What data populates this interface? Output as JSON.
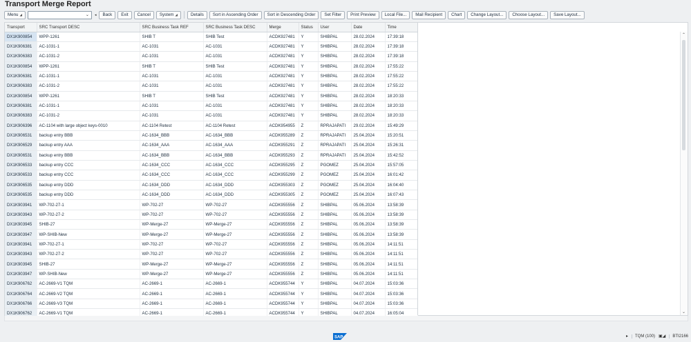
{
  "app": {
    "title": "Transport Merge Report"
  },
  "toolbar": {
    "menu_label": "Menu",
    "back_label": "Back",
    "exit_label": "Exit",
    "cancel_label": "Cancel",
    "system_label": "System",
    "details_label": "Details",
    "sort_asc_label": "Sort in Ascending Order",
    "sort_desc_label": "Sort in Descending Order",
    "set_filter_label": "Set Filter",
    "print_preview_label": "Print Preview",
    "local_file_label": "Local File...",
    "mail_recipient_label": "Mail Recipient",
    "chart_label": "Chart",
    "change_layout_label": "Change Layout...",
    "choose_layout_label": "Choose Layout...",
    "save_layout_label": "Save Layout...",
    "command_field_value": ""
  },
  "table": {
    "columns": [
      "Transport",
      "SRC Transport DESC",
      "SRC Business Task REF",
      "SRC Business Task DESC",
      "Merge",
      "Status",
      "User",
      "Date",
      "Time"
    ],
    "rows": [
      [
        "DX1K900854",
        "WPP-1261",
        "SHIB T",
        "SHIB Test",
        "ACDK927481",
        "Y",
        "SHIBPAL",
        "28.02.2024",
        "17:39:18"
      ],
      [
        "DX1K906381",
        "AC-1031-1",
        "AC-1031",
        "AC-1031",
        "ACDK927481",
        "Y",
        "SHIBPAL",
        "28.02.2024",
        "17:39:18"
      ],
      [
        "DX1K906383",
        "AC-1031-2",
        "AC-1031",
        "AC-1031",
        "ACDK927481",
        "Y",
        "SHIBPAL",
        "28.02.2024",
        "17:39:18"
      ],
      [
        "DX1K900854",
        "WPP-1261",
        "SHIB T",
        "SHIB Test",
        "ACDK927481",
        "Y",
        "SHIBPAL",
        "28.02.2024",
        "17:55:22"
      ],
      [
        "DX1K906381",
        "AC-1031-1",
        "AC-1031",
        "AC-1031",
        "ACDK927481",
        "Y",
        "SHIBPAL",
        "28.02.2024",
        "17:55:22"
      ],
      [
        "DX1K906383",
        "AC-1031-2",
        "AC-1031",
        "AC-1031",
        "ACDK927481",
        "Y",
        "SHIBPAL",
        "28.02.2024",
        "17:55:22"
      ],
      [
        "DX1K900854",
        "WPP-1261",
        "SHIB T",
        "SHIB Test",
        "ACDK927481",
        "Y",
        "SHIBPAL",
        "28.02.2024",
        "18:20:33"
      ],
      [
        "DX1K906381",
        "AC-1031-1",
        "AC-1031",
        "AC-1031",
        "ACDK927481",
        "Y",
        "SHIBPAL",
        "28.02.2024",
        "18:20:33"
      ],
      [
        "DX1K906383",
        "AC-1031-2",
        "AC-1031",
        "AC-1031",
        "ACDK927481",
        "Y",
        "SHIBPAL",
        "28.02.2024",
        "18:20:33"
      ],
      [
        "DX1K906396",
        "AC-1104 with large object keys-0010",
        "AC-1104 Retest",
        "AC-1104 Retest",
        "ACDK954955",
        "Z",
        "RPRAJAPATI",
        "29.02.2024",
        "15:49:29"
      ],
      [
        "DX1K906531",
        "backup entry BBB",
        "AC-1634_BBB",
        "AC-1634_BBB",
        "ACDK955289",
        "Z",
        "RPRAJAPATI",
        "25.04.2024",
        "15:20:51"
      ],
      [
        "DX1K906529",
        "backup entry AAA",
        "AC-1634_AAA",
        "AC-1634_AAA",
        "ACDK955291",
        "Z",
        "RPRAJAPATI",
        "25.04.2024",
        "15:26:31"
      ],
      [
        "DX1K906531",
        "backup entry BBB",
        "AC-1634_BBB",
        "AC-1634_BBB",
        "ACDK955293",
        "Z",
        "RPRAJAPATI",
        "25.04.2024",
        "15:42:52"
      ],
      [
        "DX1K906533",
        "backup entry CCC",
        "AC-1634_CCC",
        "AC-1634_CCC",
        "ACDK955295",
        "Z",
        "PGOMEZ",
        "25.04.2024",
        "15:57:05"
      ],
      [
        "DX1K906533",
        "backup entry CCC",
        "AC-1634_CCC",
        "AC-1634_CCC",
        "ACDK955299",
        "Z",
        "PGOMEZ",
        "25.04.2024",
        "16:01:42"
      ],
      [
        "DX1K906535",
        "backup entry DDD",
        "AC-1634_DDD",
        "AC-1634_DDD",
        "ACDK955303",
        "Z",
        "PGOMEZ",
        "25.04.2024",
        "16:04:40"
      ],
      [
        "DX1K906535",
        "backup entry DDD",
        "AC-1634_DDD",
        "AC-1634_DDD",
        "ACDK955305",
        "Z",
        "PGOMEZ",
        "25.04.2024",
        "16:07:43"
      ],
      [
        "DX1K903941",
        "WP-702-27-1",
        "WP-702-27",
        "WP-702-27",
        "ACDK955556",
        "Z",
        "SHIBPAL",
        "05.06.2024",
        "13:58:39"
      ],
      [
        "DX1K903943",
        "WP-702-27-2",
        "WP-702-27",
        "WP-702-27",
        "ACDK955556",
        "Z",
        "SHIBPAL",
        "05.06.2024",
        "13:58:39"
      ],
      [
        "DX1K903945",
        "SHIB-27",
        "WP-Merge-27",
        "WP-Merge-27",
        "ACDK955556",
        "Z",
        "SHIBPAL",
        "05.06.2024",
        "13:58:39"
      ],
      [
        "DX1K903947",
        "WP-SHIB-New",
        "WP-Merge-27",
        "WP-Merge-27",
        "ACDK955556",
        "Z",
        "SHIBPAL",
        "05.06.2024",
        "13:58:39"
      ],
      [
        "DX1K903941",
        "WP-702-27-1",
        "WP-702-27",
        "WP-702-27",
        "ACDK955556",
        "Z",
        "SHIBPAL",
        "05.06.2024",
        "14:11:51"
      ],
      [
        "DX1K903943",
        "WP-702-27-2",
        "WP-702-27",
        "WP-702-27",
        "ACDK955556",
        "Z",
        "SHIBPAL",
        "05.06.2024",
        "14:11:51"
      ],
      [
        "DX1K903945",
        "SHIB-27",
        "WP-Merge-27",
        "WP-Merge-27",
        "ACDK955556",
        "Z",
        "SHIBPAL",
        "05.06.2024",
        "14:11:51"
      ],
      [
        "DX1K903947",
        "WP-SHIB-New",
        "WP-Merge-27",
        "WP-Merge-27",
        "ACDK955556",
        "Z",
        "SHIBPAL",
        "05.06.2024",
        "14:11:51"
      ],
      [
        "DX1K906762",
        "AC-2669-V1 TQM",
        "AC-2669-1",
        "AC-2669-1",
        "ACDK955744",
        "Y",
        "SHIBPAL",
        "04.07.2024",
        "15:03:36"
      ],
      [
        "DX1K906764",
        "AC-2669-V2 TQM",
        "AC-2669-1",
        "AC-2669-1",
        "ACDK955744",
        "Y",
        "SHIBPAL",
        "04.07.2024",
        "15:03:36"
      ],
      [
        "DX1K906766",
        "AC-2669-V3 TQM",
        "AC-2669-1",
        "AC-2669-1",
        "ACDK955744",
        "Y",
        "SHIBPAL",
        "04.07.2024",
        "15:03:36"
      ],
      [
        "DX1K906762",
        "AC-2669-V1 TQM",
        "AC-2669-1",
        "AC-2669-1",
        "ACDK955744",
        "Y",
        "SHIBPAL",
        "04.07.2024",
        "16:05:04"
      ]
    ]
  },
  "statusbar": {
    "logo_text": "SAP",
    "system_info": "TQM (100)",
    "server": "BTI2166"
  },
  "colors": {
    "background": "#eef0f2",
    "key_column": "#e8eef3",
    "selected_cell": "#d6e4f2",
    "sap_blue": "#0a6ed1"
  }
}
